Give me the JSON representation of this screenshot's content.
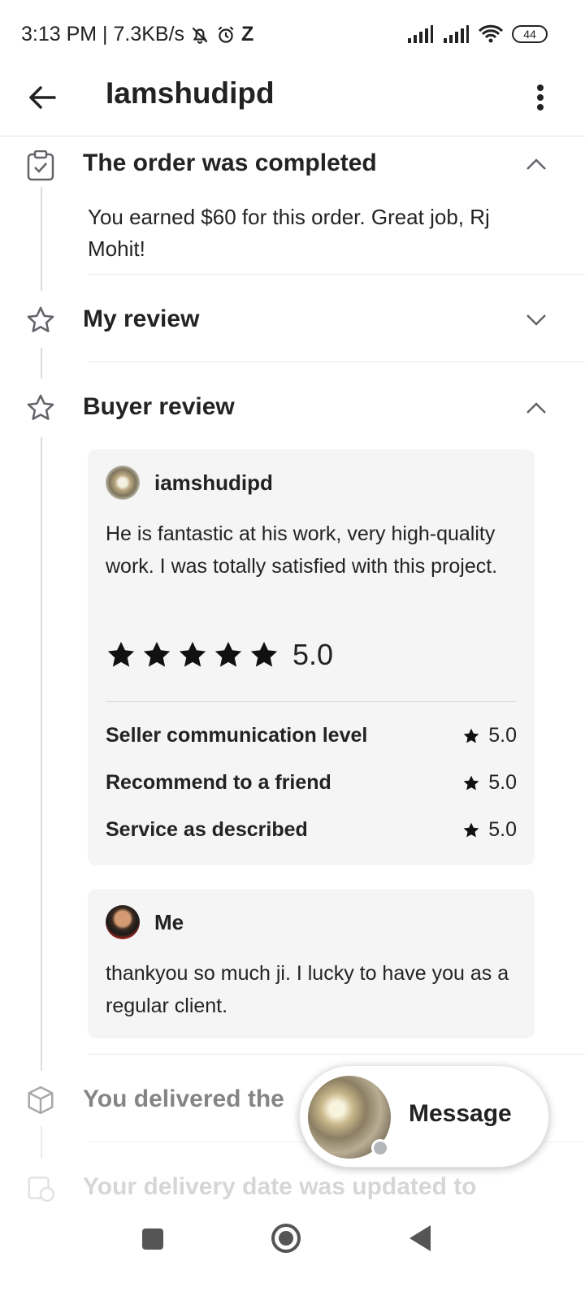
{
  "status": {
    "time": "3:13 PM | 7.3KB/s",
    "extra": "Z",
    "battery": "44"
  },
  "header": {
    "title": "Iamshudipd"
  },
  "sections": {
    "completed": {
      "title": "The order was completed",
      "message": "You earned $60 for this order. Great job, Rj Mohit!"
    },
    "my_review": {
      "title": "My review"
    },
    "buyer_review": {
      "title": "Buyer review",
      "review": {
        "username": "iamshudipd",
        "text": "He is fantastic at his work, very high-quality work. I was totally satisfied with this project.",
        "rating": "5.0",
        "stars": 5,
        "breakdown": [
          {
            "label": "Seller communication level",
            "value": "5.0"
          },
          {
            "label": "Recommend to a friend",
            "value": "5.0"
          },
          {
            "label": "Service as described",
            "value": "5.0"
          }
        ]
      },
      "reply": {
        "username": "Me",
        "text": "thankyou so much ji. I lucky to have you as a regular client."
      }
    },
    "delivered": {
      "title": "You delivered the"
    },
    "delivery_date": {
      "title": "Your delivery date was updated to"
    }
  },
  "message_button": {
    "label": "Message"
  }
}
